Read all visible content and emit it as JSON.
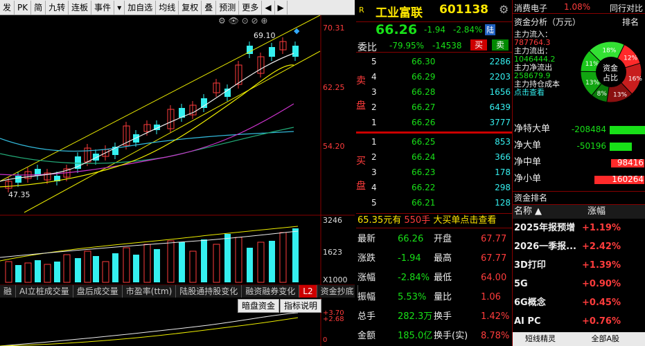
{
  "toolbar": {
    "items": [
      "发",
      "PK",
      "简",
      "九转",
      "连板",
      "事件",
      "▾",
      "加自选",
      "均线",
      "复权",
      "叠",
      "预测",
      "更多",
      "◀",
      "▶"
    ]
  },
  "stock": {
    "badge": "R",
    "name": "工业富联",
    "code": "601138",
    "price": "66.26",
    "change": "-1.94",
    "pct": "-2.84%",
    "market": "陆"
  },
  "webi": {
    "label": "委比",
    "ratio": "-79.95%",
    "diff": "-14538",
    "sell_btn": "买",
    "buy_btn": "卖"
  },
  "sell": {
    "label1": "卖",
    "label2": "盘",
    "rows": [
      {
        "n": "5",
        "p": "66.30",
        "v": "2286"
      },
      {
        "n": "4",
        "p": "66.29",
        "v": "2203"
      },
      {
        "n": "3",
        "p": "66.28",
        "v": "1656"
      },
      {
        "n": "2",
        "p": "66.27",
        "v": "6439"
      },
      {
        "n": "1",
        "p": "66.26",
        "v": "3777"
      }
    ]
  },
  "buy": {
    "label1": "买",
    "label2": "盘",
    "rows": [
      {
        "n": "1",
        "p": "66.25",
        "v": "853"
      },
      {
        "n": "2",
        "p": "66.24",
        "v": "366"
      },
      {
        "n": "3",
        "p": "66.23",
        "v": "178"
      },
      {
        "n": "4",
        "p": "66.22",
        "v": "298"
      },
      {
        "n": "5",
        "p": "66.21",
        "v": "128"
      }
    ]
  },
  "bigorder": {
    "price": "65.35元有",
    "qty": "550手",
    "text": "大买单点击查看"
  },
  "quote": [
    {
      "k1": "最新",
      "v1": "66.26",
      "k2": "开盘",
      "v2": "67.77"
    },
    {
      "k1": "涨跌",
      "v1": "-1.94",
      "k2": "最高",
      "v2": "67.77"
    },
    {
      "k1": "涨幅",
      "v1": "-2.84%",
      "k2": "最低",
      "v2": "64.00"
    },
    {
      "k1": "振幅",
      "v1": "5.53%",
      "k2": "量比",
      "v2": "1.06"
    },
    {
      "k1": "总手",
      "v1": "282.3万",
      "k2": "换手",
      "v2": "1.42%"
    },
    {
      "k1": "金额",
      "v1": "185.0亿",
      "k2": "换手(实)",
      "v2": "8.78%"
    }
  ],
  "right": {
    "top_name": "消费电子",
    "top_pct": "1.08%",
    "top_right": "同行对比",
    "fund_title": "资金分析（万元）",
    "rank_link": "排名",
    "inflow_label": "主力流入：",
    "inflow": "787764.3",
    "outflow_label": "主力流出：",
    "outflow": "1046444.2",
    "net_label": "主力净流出",
    "net": "258679.9",
    "cost_label": "主力持仓成本",
    "cost_link": "点击查看",
    "pie_center1": "资金",
    "pie_center2": "占比",
    "pie": [
      {
        "pct": "12%",
        "value": 12,
        "color": "#ff2a2a"
      },
      {
        "pct": "16%",
        "value": 16,
        "color": "#c81e1e"
      },
      {
        "pct": "13%",
        "value": 13,
        "color": "#8a1010"
      },
      {
        "pct": "8%",
        "value": 8,
        "color": "#0a7a0a"
      },
      {
        "pct": "13%",
        "value": 13,
        "color": "#11a511"
      },
      {
        "pct": "11%",
        "value": 11,
        "color": "#1ac61a"
      },
      {
        "pct": "18%",
        "value": 18,
        "color": "#33e033"
      }
    ],
    "nets": [
      {
        "k": "净特大单",
        "v": "-208484",
        "c": "#18e018",
        "w": 0.95
      },
      {
        "k": "净大单",
        "v": "-50196",
        "c": "#18e018",
        "w": 0.4
      },
      {
        "k": "净中单",
        "v": "98416",
        "c": "#ff2a2a",
        "w": 0.6
      },
      {
        "k": "净小单",
        "v": "160264",
        "c": "#ff2a2a",
        "w": 0.9
      }
    ],
    "rank_title": "资金排名",
    "col1": "名称",
    "col2": "涨幅",
    "ranks": [
      {
        "n": "2025年报预增",
        "p": "+1.19%"
      },
      {
        "n": "2026一季报...",
        "p": "+2.42%"
      },
      {
        "n": "3D打印",
        "p": "+1.39%"
      },
      {
        "n": "5G",
        "p": "+0.90%"
      },
      {
        "n": "6G概念",
        "p": "+0.45%"
      },
      {
        "n": "AI PC",
        "p": "+0.76%"
      }
    ],
    "bottom": [
      "短线精灵",
      "全部A股"
    ]
  },
  "chart": {
    "y1": "70.31",
    "y2": "62.25",
    "y3": "54.20",
    "hi": "69.10",
    "lo": "47.35",
    "v1": "3246",
    "v2": "1623",
    "v3": "X1000",
    "a1": "+3.70",
    "a2": "+2.68",
    "a3": "0"
  },
  "tabs": [
    "融",
    "AI立桩成交量",
    "盘后成交量",
    "市盈率(ttm)",
    "陆股通持股变化",
    "融资融券变化",
    "L2",
    "资金抄底"
  ],
  "sub_btns": [
    "暗盘资金",
    "指标说明"
  ]
}
